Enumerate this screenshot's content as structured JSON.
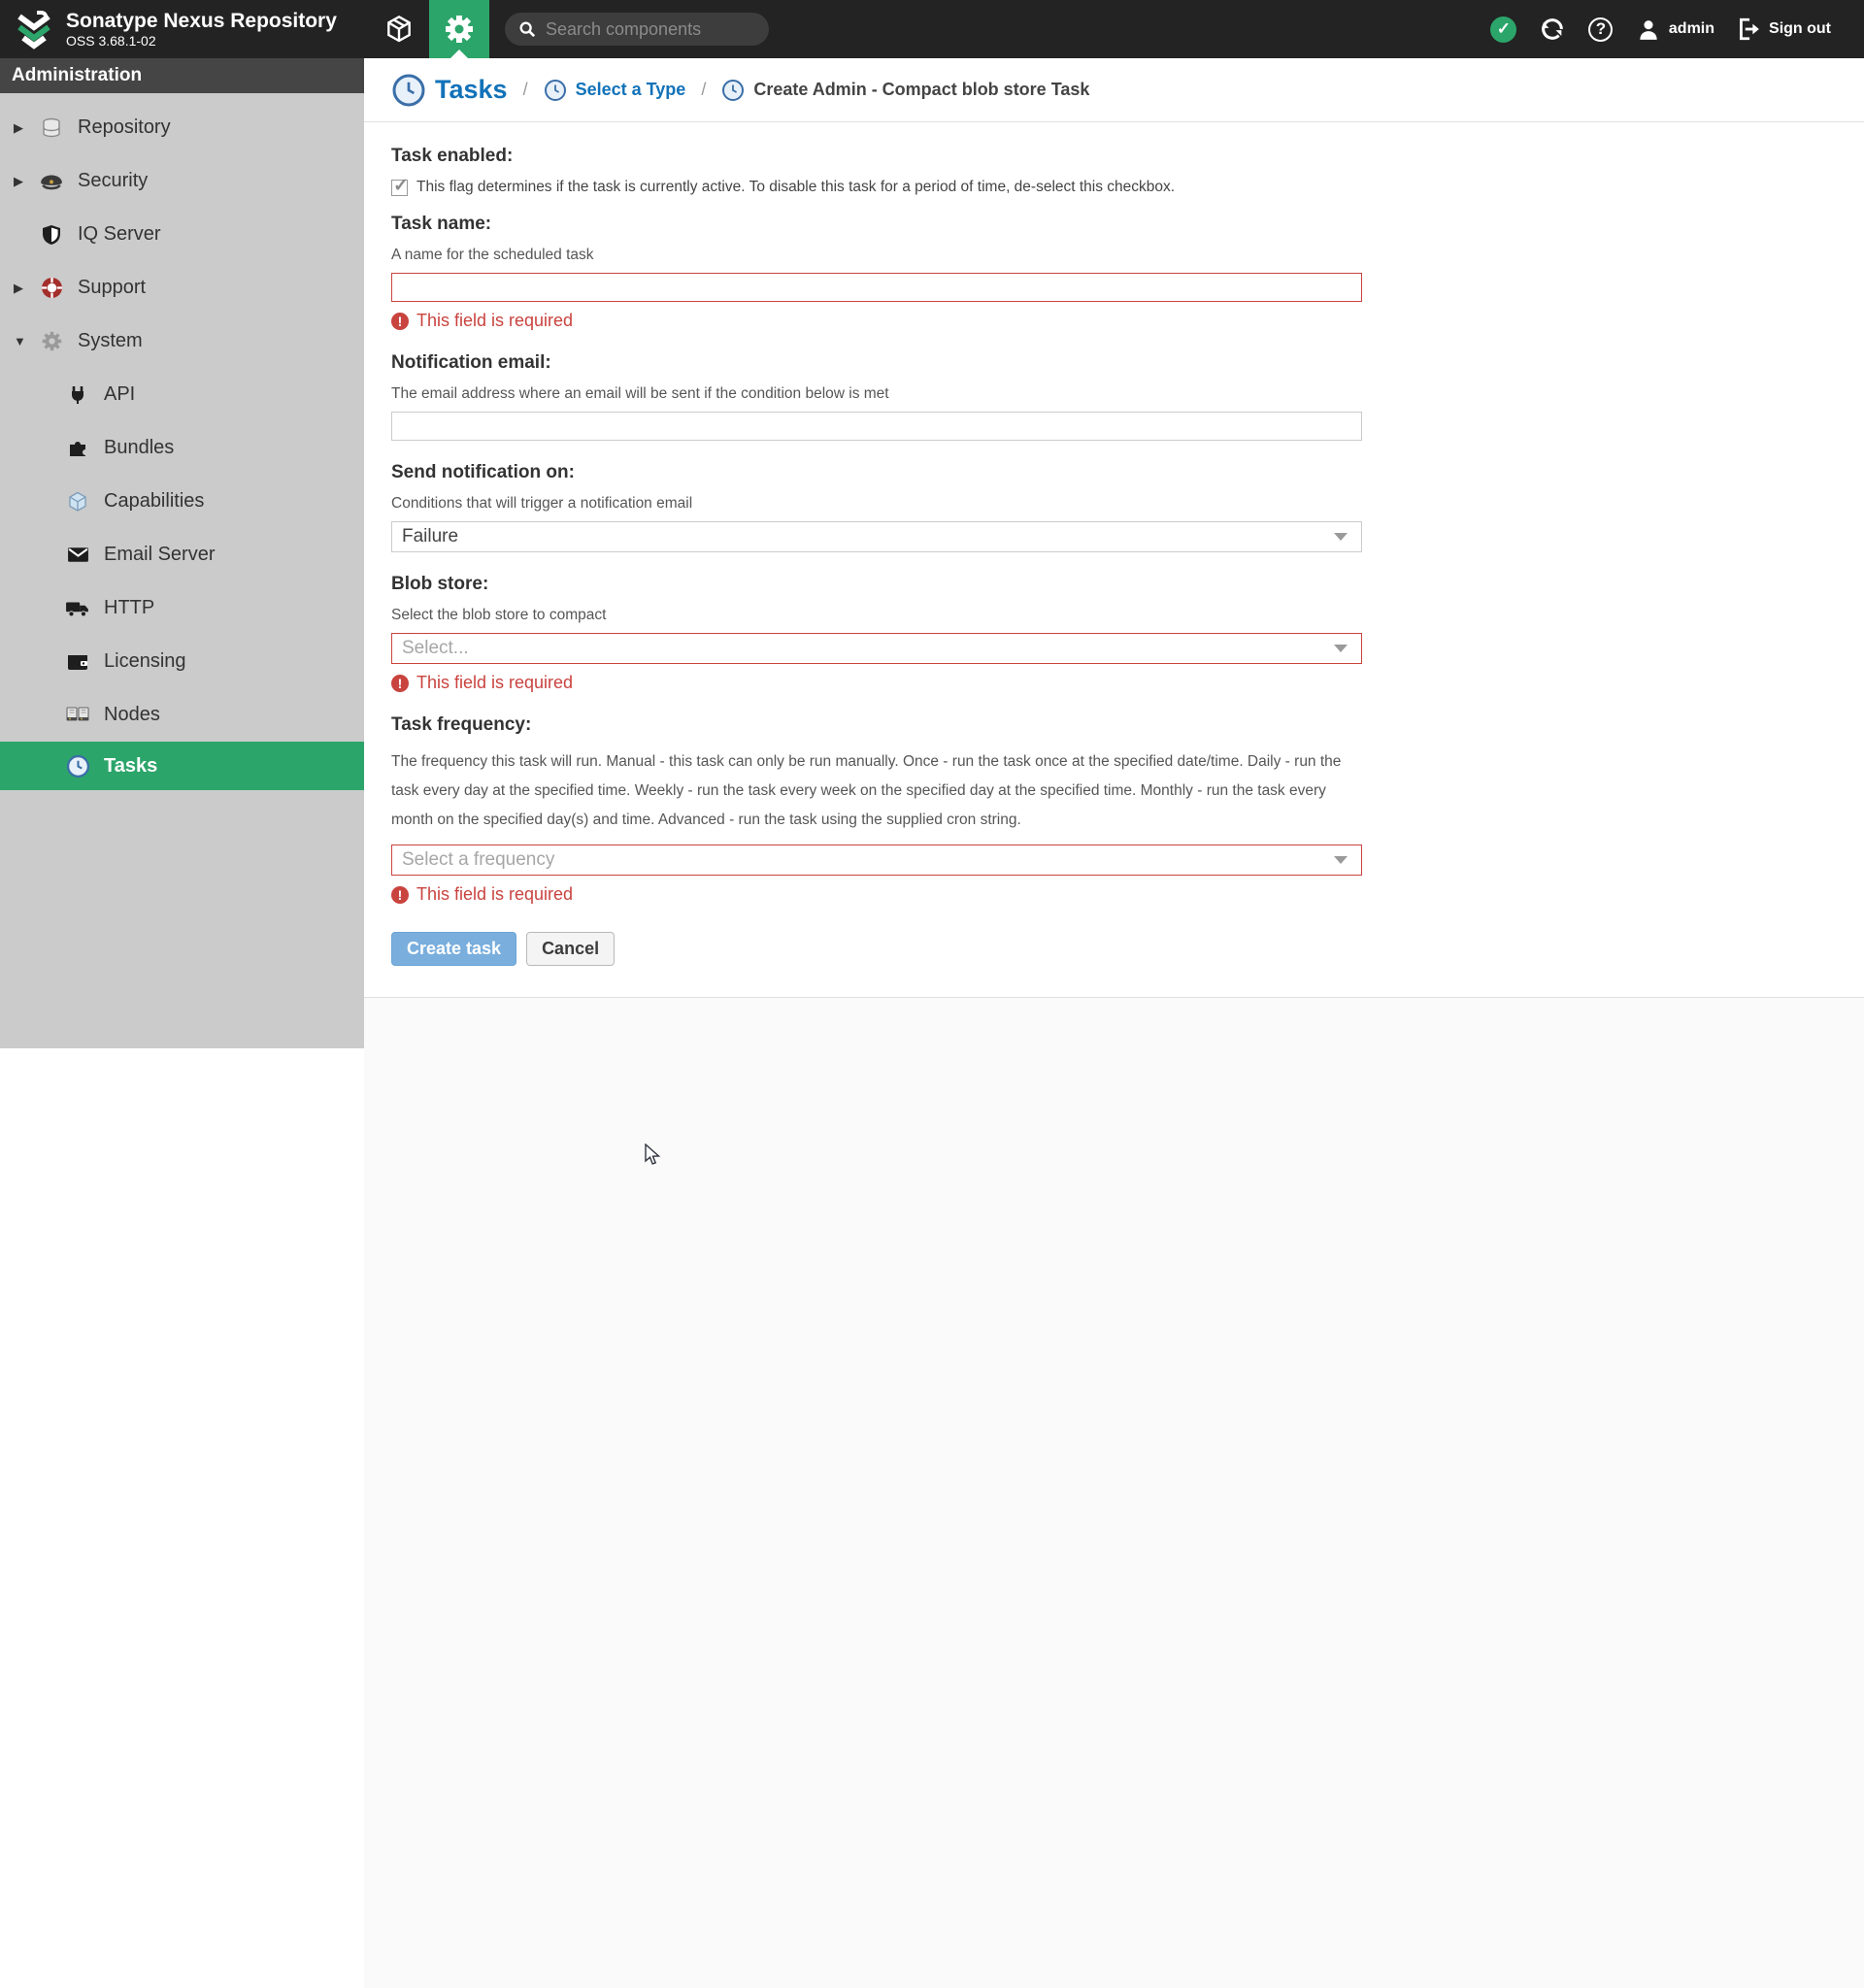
{
  "header": {
    "brand_title": "Sonatype Nexus Repository",
    "brand_version": "OSS 3.68.1-02",
    "search_placeholder": "Search components",
    "username": "admin",
    "sign_out_label": "Sign out",
    "check_glyph": "✓",
    "help_glyph": "?",
    "icons": [
      "browse-cube-icon",
      "admin-gear-icon",
      "health-check-icon",
      "refresh-icon",
      "help-icon",
      "user-icon",
      "sign-out-icon"
    ]
  },
  "sidebar": {
    "section_title": "Administration",
    "items": [
      {
        "label": "Repository",
        "icon": "database-icon",
        "arrow": "▶",
        "level": 0,
        "active": false
      },
      {
        "label": "Security",
        "icon": "police-cap-icon",
        "arrow": "▶",
        "level": 0,
        "active": false
      },
      {
        "label": "IQ Server",
        "icon": "shield-icon",
        "arrow": "",
        "level": 0,
        "active": false
      },
      {
        "label": "Support",
        "icon": "life-ring-icon",
        "arrow": "▶",
        "level": 0,
        "active": false
      },
      {
        "label": "System",
        "icon": "gear-icon",
        "arrow": "▼",
        "level": 0,
        "active": false
      },
      {
        "label": "API",
        "icon": "plug-icon",
        "arrow": "",
        "level": 1,
        "active": false
      },
      {
        "label": "Bundles",
        "icon": "puzzle-icon",
        "arrow": "",
        "level": 1,
        "active": false
      },
      {
        "label": "Capabilities",
        "icon": "cube-icon",
        "arrow": "",
        "level": 1,
        "active": false
      },
      {
        "label": "Email Server",
        "icon": "envelope-icon",
        "arrow": "",
        "level": 1,
        "active": false
      },
      {
        "label": "HTTP",
        "icon": "truck-icon",
        "arrow": "",
        "level": 1,
        "active": false
      },
      {
        "label": "Licensing",
        "icon": "wallet-icon",
        "arrow": "",
        "level": 1,
        "active": false
      },
      {
        "label": "Nodes",
        "icon": "servers-icon",
        "arrow": "",
        "level": 1,
        "active": false
      },
      {
        "label": "Tasks",
        "icon": "clock-icon",
        "arrow": "",
        "level": 1,
        "active": true
      }
    ]
  },
  "breadcrumb": {
    "root": "Tasks",
    "sep": "/",
    "type_step": "Select a Type",
    "current": "Create Admin - Compact blob store Task"
  },
  "form": {
    "task_enabled": {
      "label": "Task enabled:",
      "description": "This flag determines if the task is currently active. To disable this task for a period of time, de-select this checkbox.",
      "checked": true,
      "check_glyph": "✓"
    },
    "task_name": {
      "label": "Task name:",
      "helper": "A name for the scheduled task",
      "value": "",
      "error": "This field is required"
    },
    "notification_email": {
      "label": "Notification email:",
      "helper": "The email address where an email will be sent if the condition below is met",
      "value": ""
    },
    "send_notification_on": {
      "label": "Send notification on:",
      "helper": "Conditions that will trigger a notification email",
      "value": "Failure"
    },
    "blob_store": {
      "label": "Blob store:",
      "helper": "Select the blob store to compact",
      "placeholder": "Select...",
      "error": "This field is required"
    },
    "task_frequency": {
      "label": "Task frequency:",
      "helper": "The frequency this task will run. Manual - this task can only be run manually. Once - run the task once at the specified date/time. Daily - run the task every day at the specified time. Weekly - run the task every week on the specified day at the specified time. Monthly - run the task every month on the specified day(s) and time. Advanced - run the task using the supplied cron string.",
      "placeholder": "Select a frequency",
      "error": "This field is required"
    },
    "actions": {
      "create": "Create task",
      "cancel": "Cancel"
    },
    "error_glyph": "!"
  },
  "colors": {
    "accent_green": "#2ca56a",
    "brand_blue": "#1272b9",
    "error_red": "#c9433f"
  }
}
